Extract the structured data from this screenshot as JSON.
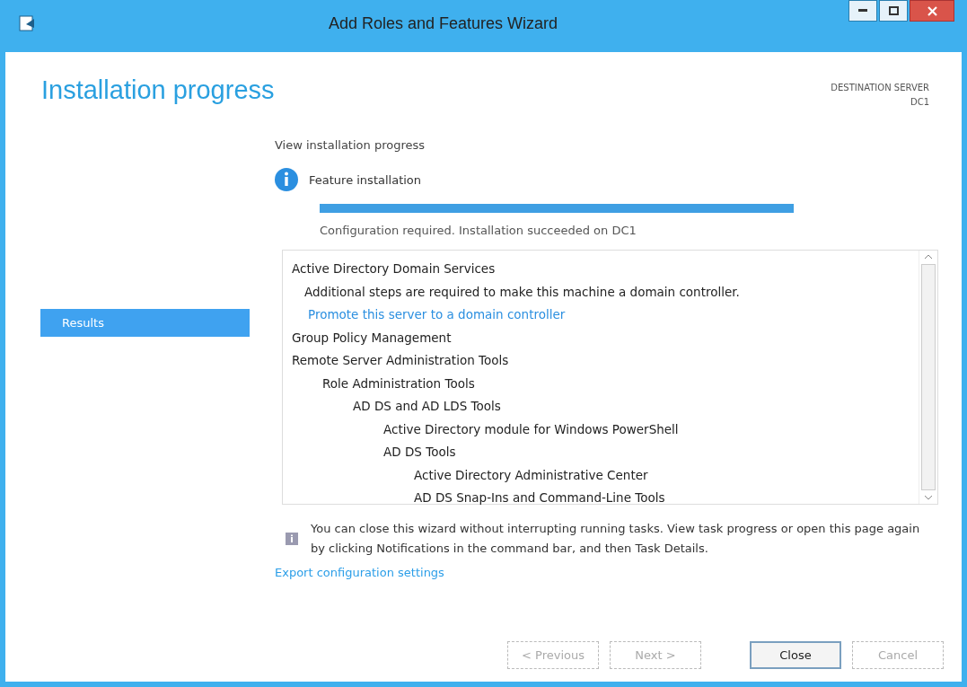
{
  "window": {
    "title": "Add Roles and Features Wizard"
  },
  "page_title": "Installation progress",
  "destination": {
    "label": "DESTINATION SERVER",
    "server": "DC1"
  },
  "sidebar": {
    "items": [
      {
        "label": "Results",
        "selected": true
      }
    ]
  },
  "section_title": "View installation progress",
  "progress": {
    "title": "Feature installation",
    "level": 1,
    "status": "Configuration required. Installation succeeded on DC1"
  },
  "results": [
    {
      "label": "Active Directory Domain Services",
      "description": "Additional steps are required to make this machine a domain controller.",
      "link": "Promote this server to a domain controller"
    },
    {
      "label": "Group Policy Management"
    },
    {
      "label": "Remote Server Administration Tools",
      "children": [
        {
          "label": "Role Administration Tools",
          "children": [
            {
              "label": "AD DS and AD LDS Tools",
              "children": [
                {
                  "label": "Active Directory module for Windows PowerShell"
                },
                {
                  "label": "AD DS Tools",
                  "children": [
                    {
                      "label": "Active Directory Administrative Center"
                    },
                    {
                      "label": "AD DS Snap-Ins and Command-Line Tools"
                    }
                  ]
                }
              ]
            }
          ]
        }
      ]
    }
  ],
  "note": "You can close this wizard without interrupting running tasks. View task progress or open this page again by clicking Notifications in the command bar, and then Task Details.",
  "export_link": "Export configuration settings",
  "buttons": [
    {
      "label": "< Previous",
      "disabled": true,
      "default": false
    },
    {
      "label": "Next >",
      "disabled": true,
      "default": false
    },
    {
      "label": "Close",
      "disabled": false,
      "default": true
    },
    {
      "label": "Cancel",
      "disabled": true,
      "default": false
    }
  ]
}
